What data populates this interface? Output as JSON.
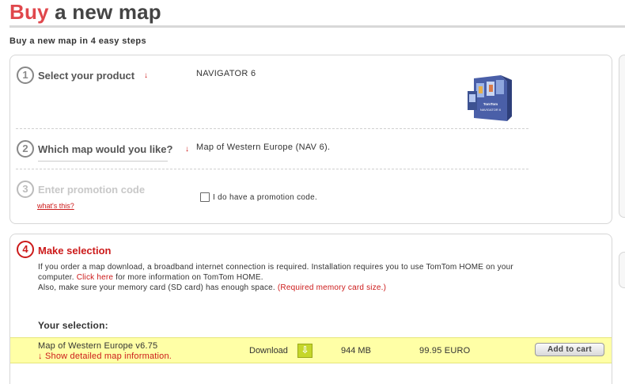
{
  "header": {
    "title_accent": "Buy",
    "title_rest": "a new map",
    "subtitle": "Buy a new map in 4 easy steps"
  },
  "steps": [
    {
      "number": "1",
      "label": "Select your product",
      "value": "NAVIGATOR 6"
    },
    {
      "number": "2",
      "label": "Which map would you like?",
      "value": "Map of Western Europe (NAV 6)."
    },
    {
      "number": "3",
      "label": "Enter promotion code",
      "help_link": "what's this?",
      "checkbox_label": "I do have a promotion code."
    },
    {
      "number": "4",
      "label": "Make selection"
    }
  ],
  "info": {
    "line1": "If you order a map download, a broadband internet connection is required. Installation requires you to use TomTom HOME on your",
    "line2_pre": "computer.",
    "line2_link": "Click here",
    "line2_post": "for more information on TomTom HOME.",
    "line3_pre": "Also, make sure your memory card (SD card) has enough space.",
    "line3_link": "(Required memory card size.)"
  },
  "selection": {
    "heading": "Your selection:",
    "item_name": "Map of Western Europe v6.75",
    "detail_link": "Show detailed map information.",
    "delivery": "Download",
    "size": "944 MB",
    "price": "99.95 EURO",
    "cart_button": "Add to cart"
  },
  "product_box": {
    "brand": "TomTom",
    "name": "NAVIGATOR 6"
  },
  "icons": {
    "arrow": "down-arrow-icon",
    "download": "download-icon"
  },
  "colors": {
    "accent": "#e0474c",
    "link_red": "#cc1a1a",
    "highlight": "#ffffa6",
    "download_icon": "#c5d62a"
  }
}
